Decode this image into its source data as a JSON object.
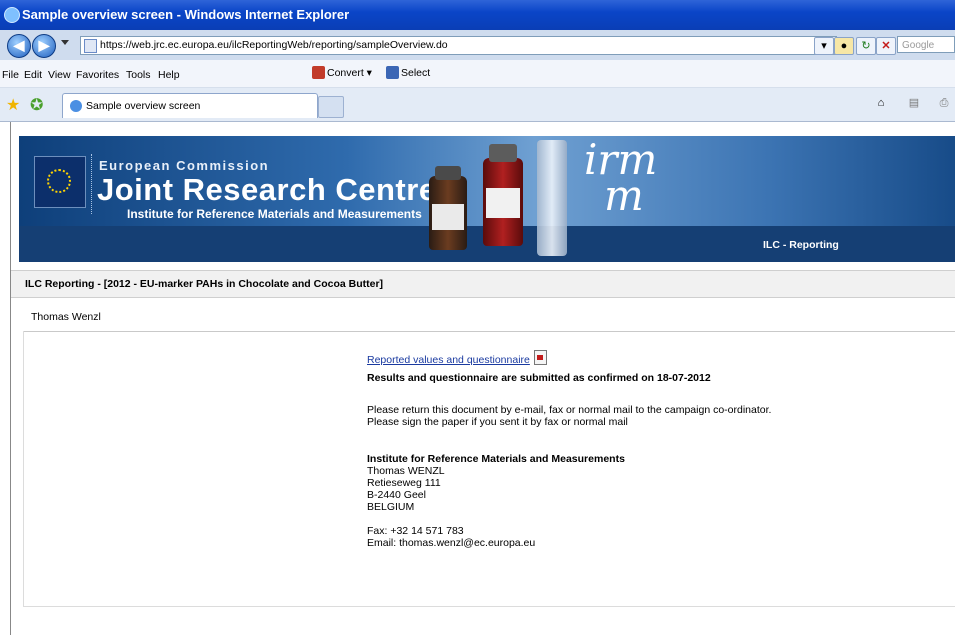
{
  "window": {
    "title": "Sample overview screen - Windows Internet Explorer"
  },
  "address": {
    "url": "https://web.jrc.ec.europa.eu/ilcReportingWeb/reporting/sampleOverview.do",
    "search_placeholder": "Google"
  },
  "menu": {
    "items": [
      "File",
      "Edit",
      "View",
      "Favorites",
      "Tools",
      "Help"
    ],
    "convert": "Convert",
    "select": "Select"
  },
  "tab": {
    "label": "Sample overview screen"
  },
  "banner": {
    "ec": "European Commission",
    "jrc": "Joint Research Centre",
    "institute": "Institute for Reference Materials and Measurements",
    "logo_line1": "irm",
    "logo_line2": "m",
    "app_label": "ILC - Reporting"
  },
  "page": {
    "header": "ILC Reporting - [2012 - EU-marker PAHs in Chocolate and Cocoa Butter]",
    "user": "Thomas  Wenzl",
    "link": "Reported values and questionnaire",
    "status": "Results and questionnaire are submitted as confirmed on 18-07-2012",
    "instruction1": "Please return this document by e-mail, fax or normal mail to the campaign co-ordinator.",
    "instruction2": "Please sign the paper if you sent it by fax or normal mail",
    "address_org": "Institute for Reference Materials and Measurements",
    "address_lines": [
      "Thomas WENZL",
      "Retieseweg 111",
      "B-2440 Geel",
      "BELGIUM"
    ],
    "fax": "Fax: +32 14 571 783",
    "email": "Email: thomas.wenzl@ec.europa.eu"
  },
  "colors": {
    "titlebar": "#0a45c8",
    "banner": "#14457f",
    "link": "#1a3aa0"
  }
}
